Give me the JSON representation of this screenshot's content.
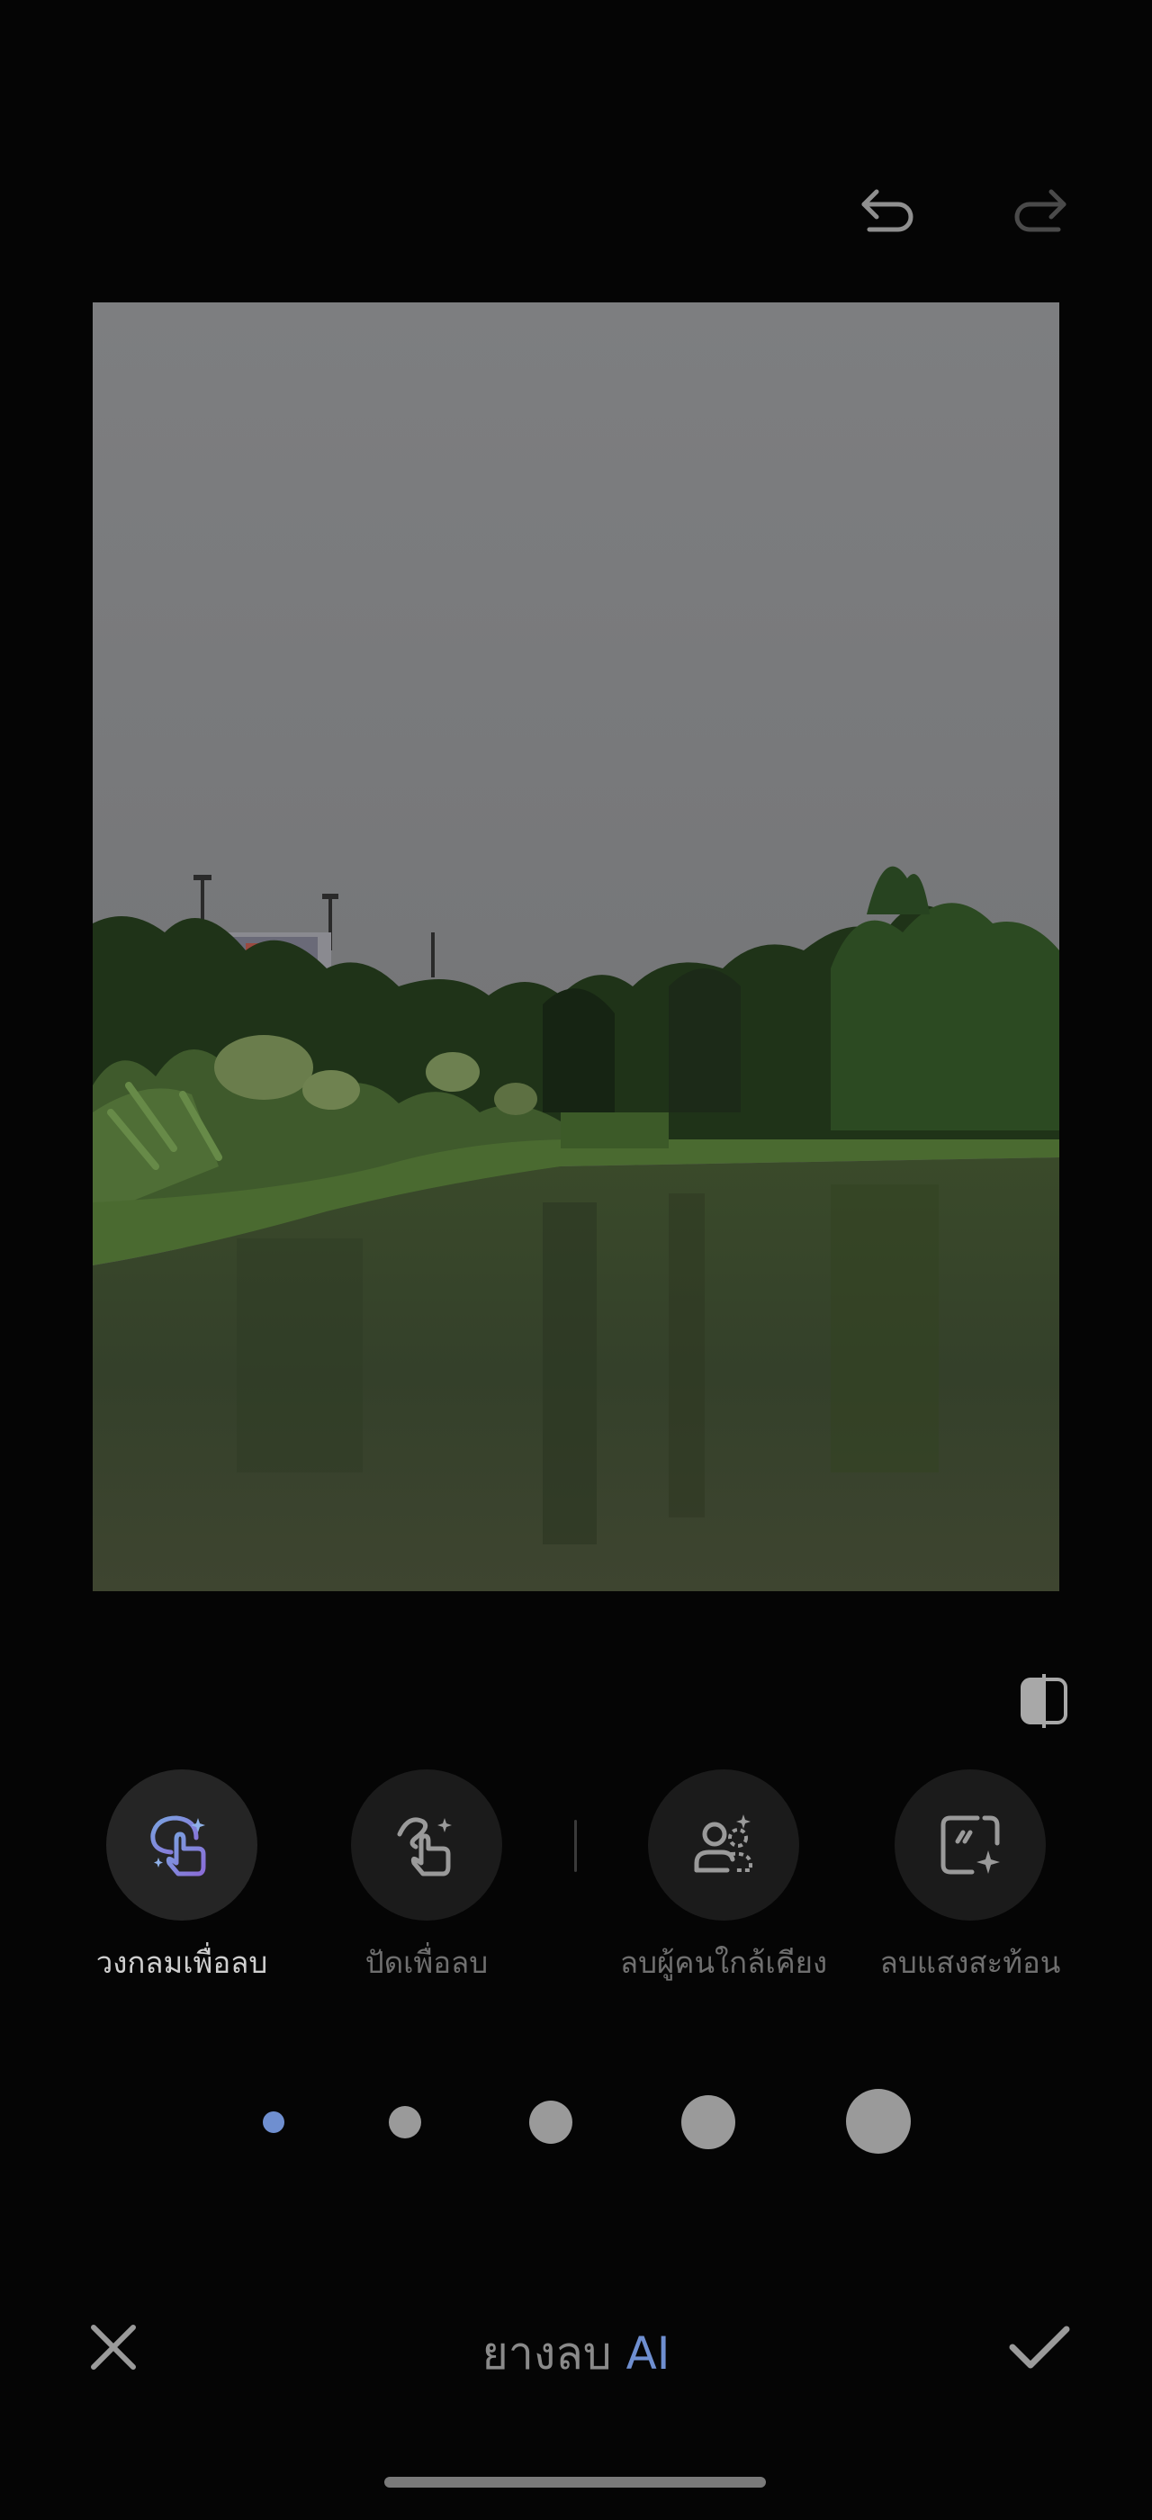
{
  "header": {
    "undo_icon": "undo-icon",
    "redo_icon": "redo-icon"
  },
  "photo": {
    "description_icon": "photo-canvas"
  },
  "compare": {
    "icon": "compare-icon"
  },
  "tools": [
    {
      "label": "วงกลมเพื่อลบ",
      "icon": "circle-to-erase-icon",
      "active": true
    },
    {
      "label": "ปัดเพื่อลบ",
      "icon": "brush-to-erase-icon",
      "active": false
    },
    {
      "label": "ลบผู้คนใกล้เคียง",
      "icon": "remove-people-icon",
      "active": false
    },
    {
      "label": "ลบแสงสะท้อน",
      "icon": "remove-reflection-icon",
      "active": false
    }
  ],
  "brush_sizes": {
    "count": 5,
    "selected_index": 0
  },
  "bottom_bar": {
    "title_main": "ยางลบ",
    "title_ai": "AI",
    "cancel_icon": "close-icon",
    "confirm_icon": "checkmark-icon"
  },
  "colors": {
    "background": "#050505",
    "accent": "#6f8fd0",
    "tool_circle": "#1b1b1b"
  }
}
